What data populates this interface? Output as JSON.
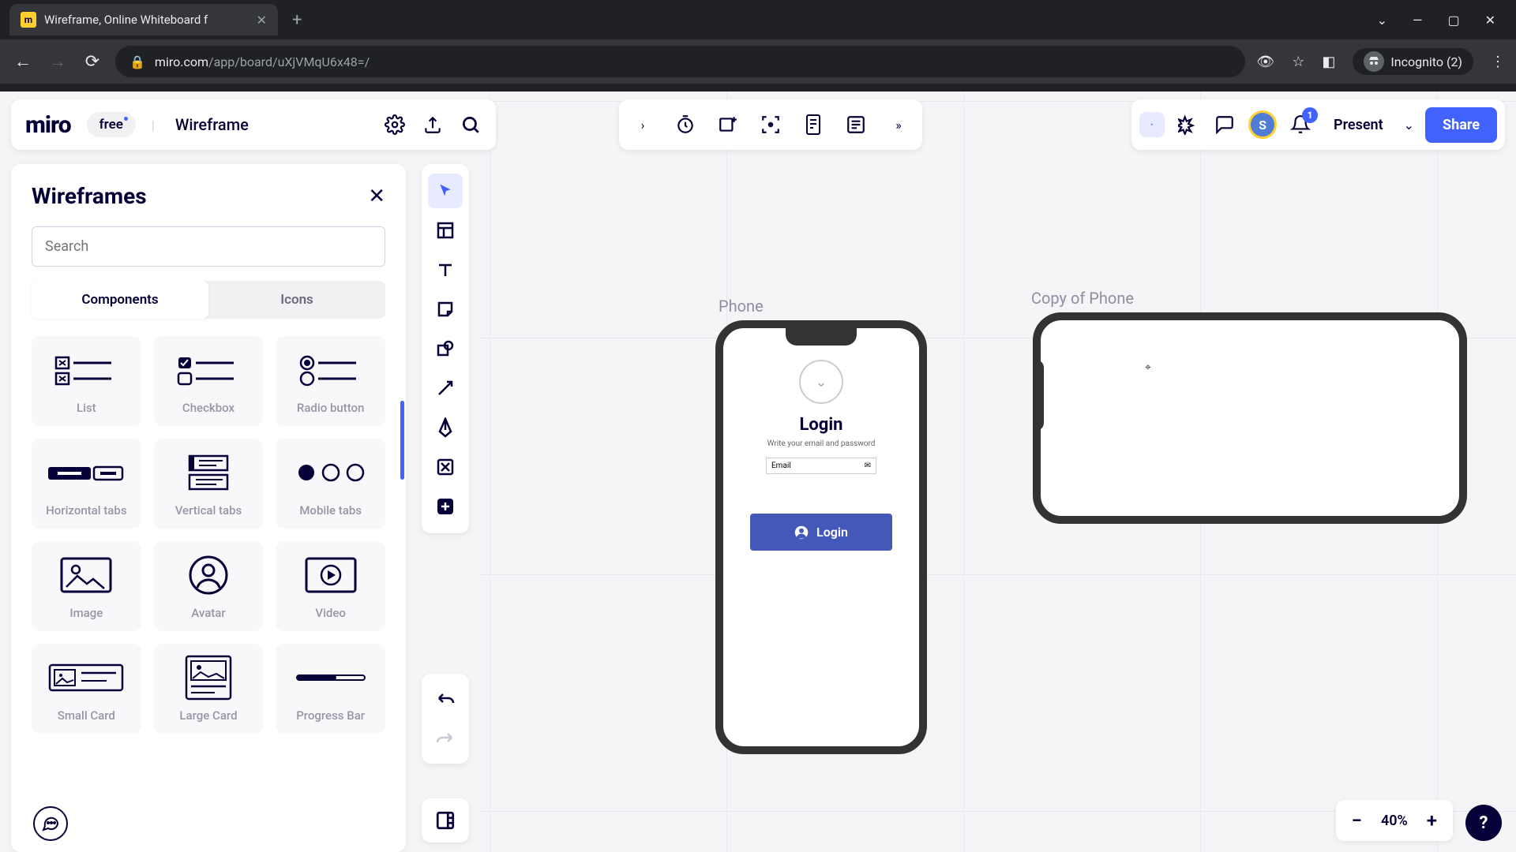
{
  "browser": {
    "tab_title": "Wireframe, Online Whiteboard f",
    "url_prefix": "miro.com",
    "url_path": "/app/board/uXjVMqU6x48=/",
    "incognito_label": "Incognito (2)"
  },
  "app_bar": {
    "logo": "miro",
    "plan": "free",
    "board_name": "Wireframe"
  },
  "right_bar": {
    "avatar_initial": "S",
    "notif_count": "1",
    "present": "Present",
    "share": "Share"
  },
  "panel": {
    "title": "Wireframes",
    "search_placeholder": "Search",
    "tab_components": "Components",
    "tab_icons": "Icons",
    "items": {
      "list": "List",
      "checkbox": "Checkbox",
      "radio": "Radio button",
      "htabs": "Horizontal tabs",
      "vtabs": "Vertical tabs",
      "mtabs": "Mobile tabs",
      "image": "Image",
      "avatar": "Avatar",
      "video": "Video",
      "small_card": "Small Card",
      "large_card": "Large Card",
      "progress": "Progress Bar"
    }
  },
  "canvas": {
    "frame1_label": "Phone",
    "frame2_label": "Copy of Phone",
    "login": {
      "title": "Login",
      "subtitle": "Write your email and password",
      "email_placeholder": "Email",
      "button": "Login"
    }
  },
  "zoom": {
    "level": "40%"
  }
}
